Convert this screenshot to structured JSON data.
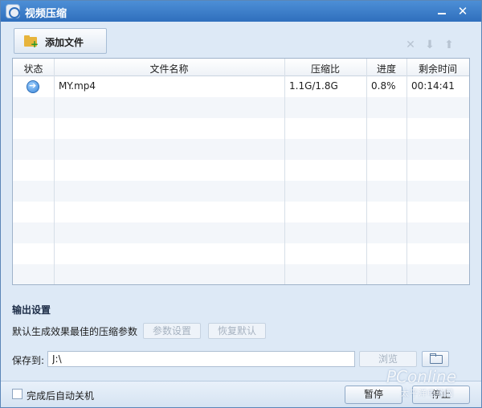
{
  "window": {
    "title": "视频压缩",
    "accent_color": "#2f6fbd"
  },
  "toolbar": {
    "add_file_label": "添加文件",
    "icons": [
      "delete-icon",
      "move-down-icon",
      "move-up-icon"
    ]
  },
  "table": {
    "columns": [
      "状态",
      "文件名称",
      "压缩比",
      "进度",
      "剩余时间"
    ],
    "rows": [
      {
        "status_icon": "arrow-right-icon",
        "filename": "MY.mp4",
        "ratio": "1.1G/1.8G",
        "progress": "0.8%",
        "remaining": "00:14:41"
      }
    ]
  },
  "output": {
    "section_title": "输出设置",
    "default_text": "默认生成效果最佳的压缩参数",
    "params_button": "参数设置",
    "restore_button": "恢复默认",
    "save_label": "保存到:",
    "path_value": "J:\\",
    "browse_button": "浏览"
  },
  "footer": {
    "auto_shutdown_label": "完成后自动关机",
    "auto_shutdown_checked": false,
    "pause_button": "暂停",
    "stop_button": "停止"
  },
  "watermark": {
    "brand": "PConline",
    "sub": "太平洋电脑网"
  }
}
